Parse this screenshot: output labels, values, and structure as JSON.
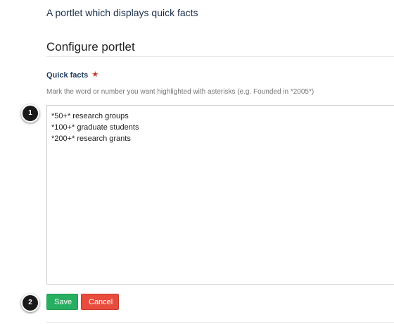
{
  "portlet": {
    "description": "A portlet which displays quick facts",
    "section_title": "Configure portlet"
  },
  "quick_facts": {
    "label": "Quick facts",
    "required_marker": "★",
    "help_text": "Mark the word or number you want highlighted with asterisks (e.g. Founded in *2005*)",
    "lines": [
      "*50+* research groups",
      "*100+* graduate students",
      "*200+* research grants"
    ]
  },
  "callouts": {
    "first": "1",
    "second": "2"
  },
  "actions": {
    "save_label": "Save",
    "cancel_label": "Cancel"
  },
  "colors": {
    "save": "#27ae60",
    "cancel": "#e74c3c",
    "label": "#1f3b5c",
    "required": "#c0392b"
  }
}
